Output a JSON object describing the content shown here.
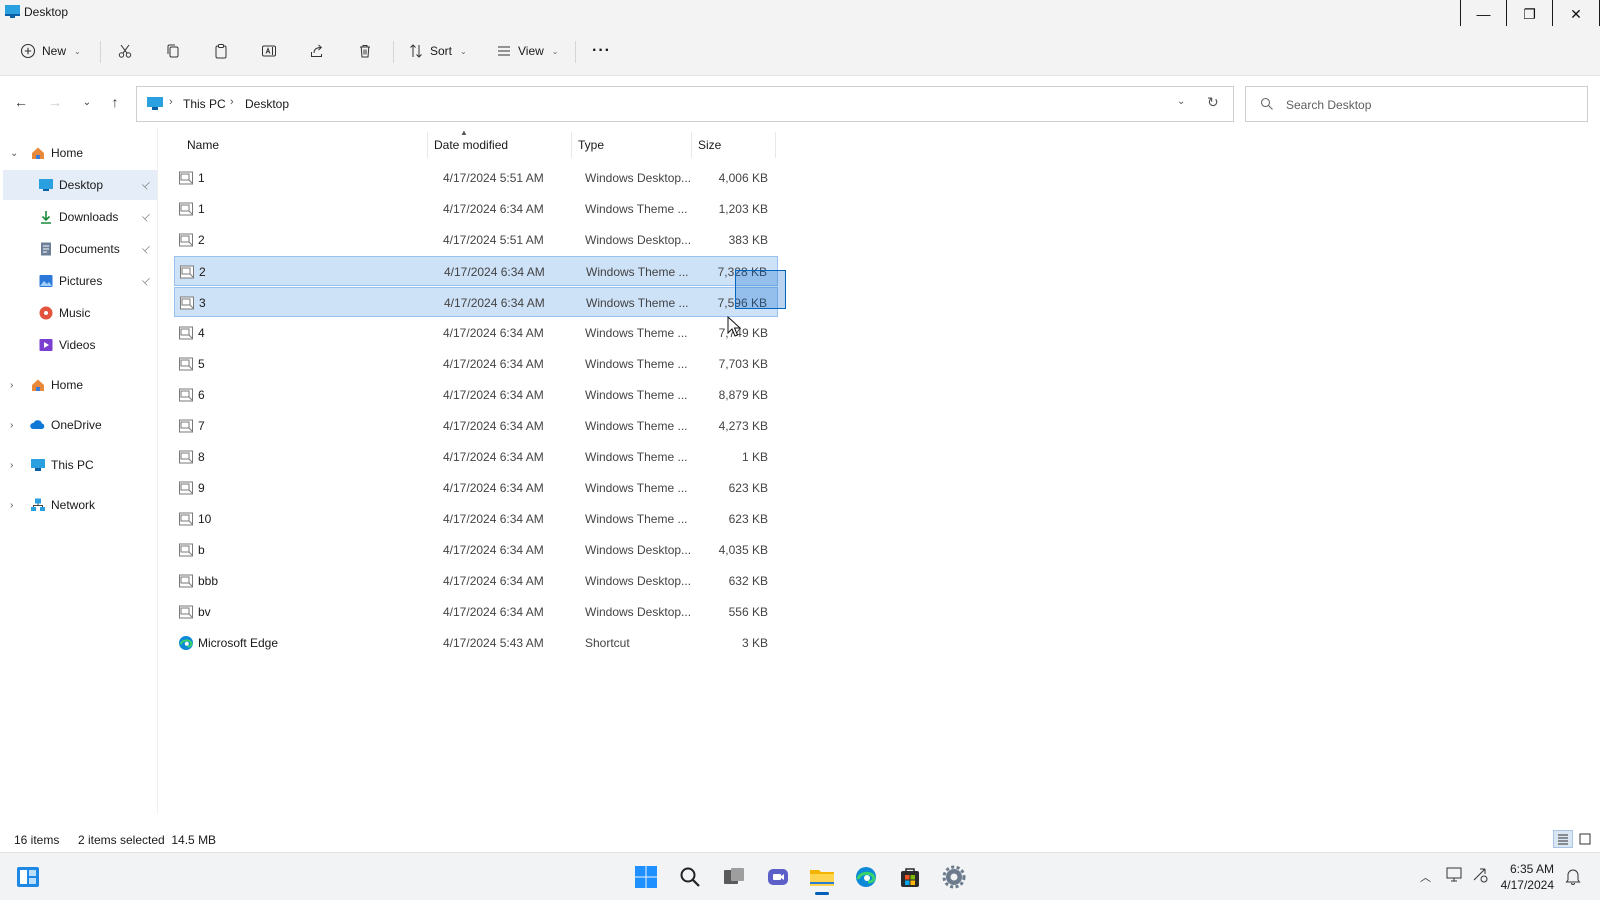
{
  "window": {
    "title": "Desktop"
  },
  "titlebar_buttons": {
    "minimize": "—",
    "maximize": "❐",
    "close": "✕"
  },
  "commandbar": {
    "new_label": "New",
    "sort_label": "Sort",
    "view_label": "View",
    "more_label": "···"
  },
  "address": {
    "crumbs": [
      "This PC",
      "Desktop"
    ],
    "separator": "›"
  },
  "search": {
    "placeholder": "Search Desktop"
  },
  "sidebar": {
    "items": [
      {
        "label": "Home",
        "icon": "home-icon",
        "expander": "⌄"
      },
      {
        "label": "Desktop",
        "icon": "desktop-icon",
        "pinned": true
      },
      {
        "label": "Downloads",
        "icon": "downloads-icon",
        "pinned": true
      },
      {
        "label": "Documents",
        "icon": "documents-icon",
        "pinned": true
      },
      {
        "label": "Pictures",
        "icon": "pictures-icon",
        "pinned": true
      },
      {
        "label": "Music",
        "icon": "music-icon"
      },
      {
        "label": "Videos",
        "icon": "videos-icon"
      },
      {
        "label": "Home",
        "icon": "home-icon",
        "expander": "›"
      },
      {
        "label": "OneDrive",
        "icon": "onedrive-icon",
        "expander": "›"
      },
      {
        "label": "This PC",
        "icon": "this-pc-icon",
        "expander": "›"
      },
      {
        "label": "Network",
        "icon": "network-icon",
        "expander": "›"
      }
    ],
    "pin_glyph": "📌"
  },
  "columns": {
    "name": "Name",
    "date": "Date modified",
    "type": "Type",
    "size": "Size"
  },
  "files": [
    {
      "name": "1",
      "date": "4/17/2024 5:51 AM",
      "type": "Windows Desktop...",
      "size": "4,006 KB",
      "selected": false
    },
    {
      "name": "1",
      "date": "4/17/2024 6:34 AM",
      "type": "Windows Theme ...",
      "size": "1,203 KB",
      "selected": false
    },
    {
      "name": "2",
      "date": "4/17/2024 5:51 AM",
      "type": "Windows Desktop...",
      "size": "383 KB",
      "selected": false
    },
    {
      "name": "2",
      "date": "4/17/2024 6:34 AM",
      "type": "Windows Theme ...",
      "size": "7,328 KB",
      "selected": true
    },
    {
      "name": "3",
      "date": "4/17/2024 6:34 AM",
      "type": "Windows Theme ...",
      "size": "7,596 KB",
      "selected": true
    },
    {
      "name": "4",
      "date": "4/17/2024 6:34 AM",
      "type": "Windows Theme ...",
      "size": "7,749 KB",
      "selected": false
    },
    {
      "name": "5",
      "date": "4/17/2024 6:34 AM",
      "type": "Windows Theme ...",
      "size": "7,703 KB",
      "selected": false
    },
    {
      "name": "6",
      "date": "4/17/2024 6:34 AM",
      "type": "Windows Theme ...",
      "size": "8,879 KB",
      "selected": false
    },
    {
      "name": "7",
      "date": "4/17/2024 6:34 AM",
      "type": "Windows Theme ...",
      "size": "4,273 KB",
      "selected": false
    },
    {
      "name": "8",
      "date": "4/17/2024 6:34 AM",
      "type": "Windows Theme ...",
      "size": "1 KB",
      "selected": false
    },
    {
      "name": "9",
      "date": "4/17/2024 6:34 AM",
      "type": "Windows Theme ...",
      "size": "623 KB",
      "selected": false
    },
    {
      "name": "10",
      "date": "4/17/2024 6:34 AM",
      "type": "Windows Theme ...",
      "size": "623 KB",
      "selected": false
    },
    {
      "name": "b",
      "date": "4/17/2024 6:34 AM",
      "type": "Windows Desktop...",
      "size": "4,035 KB",
      "selected": false
    },
    {
      "name": "bbb",
      "date": "4/17/2024 6:34 AM",
      "type": "Windows Desktop...",
      "size": "632 KB",
      "selected": false
    },
    {
      "name": "bv",
      "date": "4/17/2024 6:34 AM",
      "type": "Windows Desktop...",
      "size": "556 KB",
      "selected": false
    },
    {
      "name": "Microsoft Edge",
      "date": "4/17/2024 5:43 AM",
      "type": "Shortcut",
      "size": "3 KB",
      "selected": false,
      "icon": "edge-icon"
    }
  ],
  "status": {
    "item_count": "16 items",
    "selection": "2 items selected  14.5 MB"
  },
  "taskbar": {
    "apps": [
      "widgets-icon",
      "start-icon",
      "search-icon",
      "task-view-icon",
      "chat-icon",
      "file-explorer-icon",
      "edge-icon",
      "store-icon",
      "settings-icon"
    ],
    "active_app": "file-explorer-icon",
    "clock_time": "6:35 AM",
    "clock_date": "4/17/2024"
  },
  "colors": {
    "accent": "#0067c0",
    "selection_bg": "#cde1f7",
    "nav_selected_bg": "#e5eef8"
  }
}
